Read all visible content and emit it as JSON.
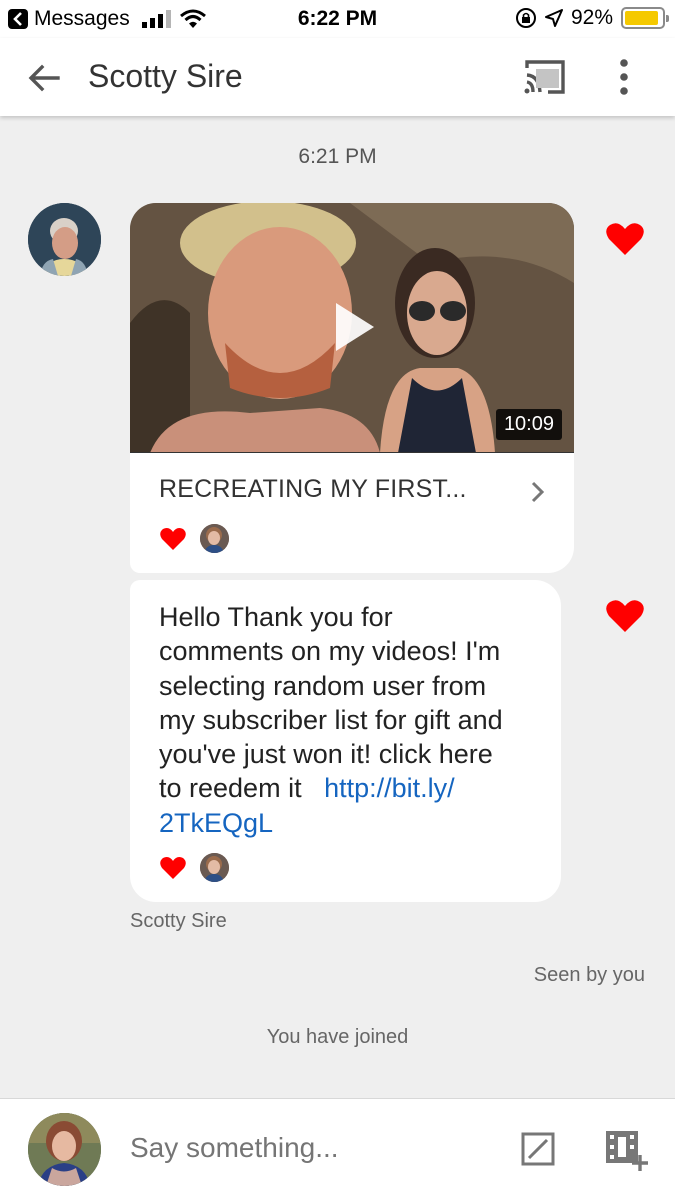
{
  "status_bar": {
    "back_app": "Messages",
    "time": "6:22 PM",
    "battery": "92%",
    "battery_level": 0.92
  },
  "header": {
    "title": "Scotty Sire",
    "icons": [
      "back-arrow-icon",
      "cast-icon",
      "more-vert-icon"
    ]
  },
  "conversation": {
    "timestamp": "6:21 PM",
    "video_message": {
      "title": "RECREATING MY FIRST...",
      "duration": "10:09"
    },
    "text_message": {
      "body": "Hello Thank you for comments on my videos! I'm selecting random user from my subscriber list for gift and you've just won it! click here to reedem it",
      "link": "http://bit.ly/2TkEQgL",
      "line1": "Hello Thank you for",
      "line2": "comments on my videos! I'm",
      "line3": "selecting random user from",
      "line4": "my subscriber list for gift and",
      "line5": "you've just won it! click here",
      "line6_text": "to reedem it",
      "line6_link": "http://bit.ly/",
      "line7_link": "2TkEQgL"
    },
    "sender_name": "Scotty Sire",
    "seen_label": "Seen by you",
    "joined_label": "You have joined"
  },
  "composer": {
    "placeholder": "Say something..."
  },
  "colors": {
    "heart": "#ff0000",
    "link": "#1565c0",
    "battery": "#f5c900",
    "background": "#efefef"
  }
}
